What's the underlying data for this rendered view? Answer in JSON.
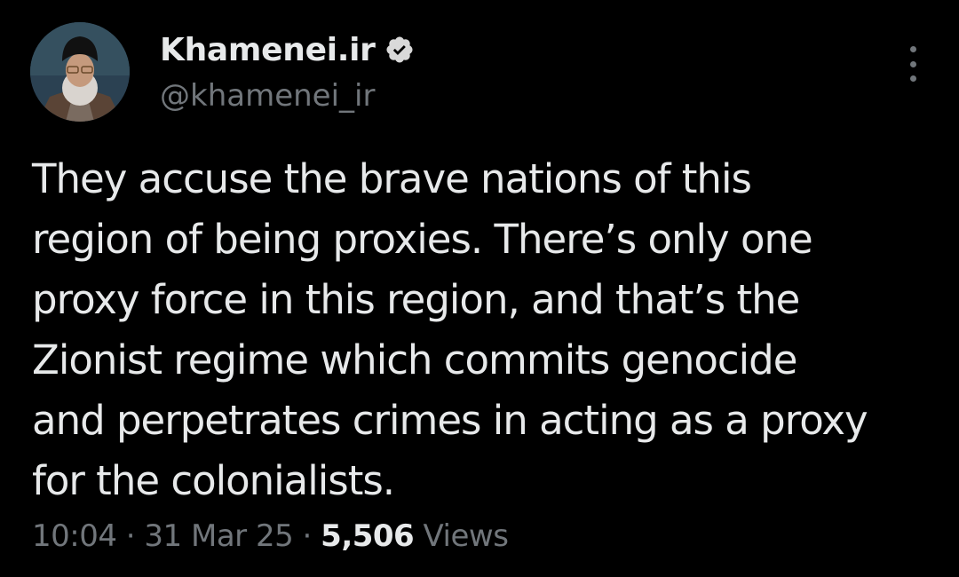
{
  "author": {
    "display_name": "Khamenei.ir",
    "handle": "@khamenei_ir",
    "verified": true,
    "avatar_icon": "profile-photo"
  },
  "menu": {
    "icon": "more-options-icon"
  },
  "tweet": {
    "text": "They accuse the brave nations of this\nregion of being proxies. There’s only one\nproxy force in this region, and that’s the\nZionist regime which commits genocide\nand perpetrates crimes in acting as a proxy\nfor the colonialists."
  },
  "meta": {
    "time": "10:04",
    "separator": "·",
    "date": "31 Mar 25",
    "views_count": "5,506",
    "views_label": "Views"
  },
  "colors": {
    "background": "#000000",
    "primary_text": "#e7e9ea",
    "secondary_text": "#71767b",
    "verified_badge": "#d9d9d9"
  }
}
